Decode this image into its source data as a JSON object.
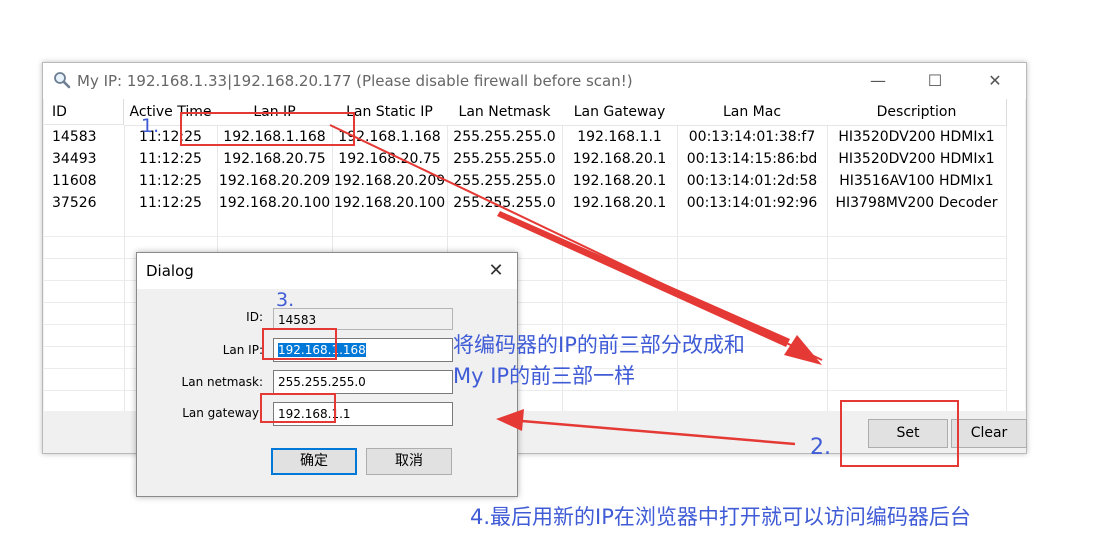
{
  "window": {
    "title": "My IP: 192.168.1.33|192.168.20.177 (Please disable firewall before scan!)",
    "minimize_glyph": "—",
    "maximize_glyph": "☐",
    "close_glyph": "✕"
  },
  "table": {
    "headers": [
      "ID",
      "Active Time",
      "Lan IP",
      "Lan Static IP",
      "Lan Netmask",
      "Lan Gateway",
      "Lan Mac",
      "Description"
    ],
    "rows": [
      [
        "14583",
        "11:12:25",
        "192.168.1.168",
        "192.168.1.168",
        "255.255.255.0",
        "192.168.1.1",
        "00:13:14:01:38:f7",
        "HI3520DV200 HDMIx1"
      ],
      [
        "34493",
        "11:12:25",
        "192.168.20.75",
        "192.168.20.75",
        "255.255.255.0",
        "192.168.20.1",
        "00:13:14:15:86:bd",
        "HI3520DV200 HDMIx1"
      ],
      [
        "11608",
        "11:12:25",
        "192.168.20.209",
        "192.168.20.209",
        "255.255.255.0",
        "192.168.20.1",
        "00:13:14:01:2d:58",
        "HI3516AV100 HDMIx1"
      ],
      [
        "37526",
        "11:12:25",
        "192.168.20.100",
        "192.168.20.100",
        "255.255.255.0",
        "192.168.20.1",
        "00:13:14:01:92:96",
        "HI3798MV200 Decoder"
      ]
    ]
  },
  "buttons": {
    "set": "Set",
    "clear": "Clear"
  },
  "dialog": {
    "title": "Dialog",
    "close_glyph": "✕",
    "id_label": "ID:",
    "id_value": "14583",
    "ip_label": "Lan IP:",
    "ip_value": "192.168.1.168",
    "netmask_label": "Lan netmask:",
    "netmask_value": "255.255.255.0",
    "gateway_label": "Lan gateway",
    "gateway_value": "192.168.1.1",
    "ok": "确定",
    "cancel": "取消"
  },
  "annotations": {
    "step1": "1.",
    "step2": "2.",
    "step3": "3.",
    "note_line1": "将编码器的IP的前三部分改成和",
    "note_line2": "My IP的前三部一样",
    "step4": "4.最后用新的IP在浏览器中打开就可以访问编码器后台"
  },
  "colors": {
    "annotation_red": "#e53935",
    "annotation_blue": "#3f5bd6",
    "selection": "#0078d7"
  }
}
